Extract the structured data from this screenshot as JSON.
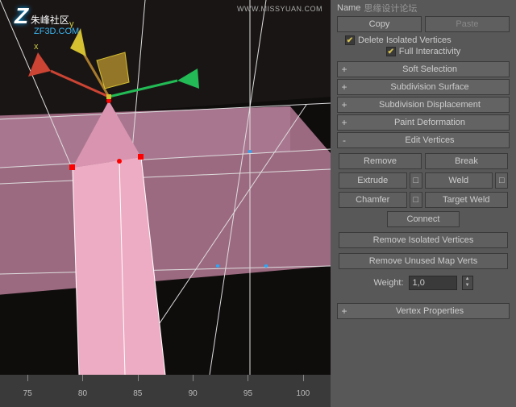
{
  "watermarks": {
    "top_right": "WWW.MISSYUAN.COM",
    "logo_cn": "朱峰社区",
    "logo_url": "ZF3D.COM",
    "center_cn": "思缘设计论坛"
  },
  "panel": {
    "name_label": "Name",
    "copy": "Copy",
    "paste": "Paste",
    "del_iso": "Delete Isolated Vertices",
    "full_int": "Full Interactivity"
  },
  "rollouts": {
    "soft_sel": "Soft Selection",
    "subd_surf": "Subdivision Surface",
    "subd_disp": "Subdivision Displacement",
    "paint_def": "Paint Deformation",
    "edit_verts": "Edit Vertices",
    "vert_props": "Vertex Properties"
  },
  "edit_verts": {
    "remove": "Remove",
    "break": "Break",
    "extrude": "Extrude",
    "weld": "Weld",
    "chamfer": "Chamfer",
    "target_weld": "Target Weld",
    "connect": "Connect",
    "rem_iso": "Remove Isolated Vertices",
    "rem_map": "Remove Unused Map Verts",
    "weight_lbl": "Weight:",
    "weight_val": "1,0"
  },
  "timeline": {
    "ticks": [
      "75",
      "80",
      "85",
      "90",
      "95",
      "100"
    ]
  },
  "axes": {
    "x": "x",
    "y": "y"
  }
}
